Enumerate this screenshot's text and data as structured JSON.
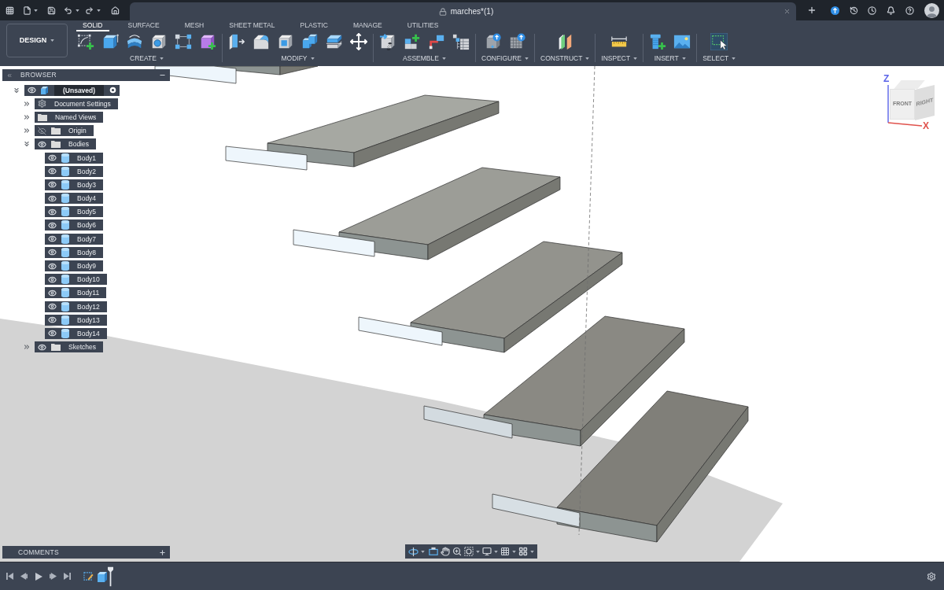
{
  "title_bar": {
    "document_tab": {
      "title": "marches*(1)"
    }
  },
  "toolbar": {
    "workspace": "DESIGN",
    "tabs": [
      {
        "label": "SOLID",
        "selected": true
      },
      {
        "label": "SURFACE",
        "selected": false
      },
      {
        "label": "MESH",
        "selected": false
      },
      {
        "label": "SHEET METAL",
        "selected": false
      },
      {
        "label": "PLASTIC",
        "selected": false
      },
      {
        "label": "MANAGE",
        "selected": false
      },
      {
        "label": "UTILITIES",
        "selected": false
      }
    ],
    "groups": [
      {
        "label": "CREATE",
        "active": false
      },
      {
        "label": "MODIFY",
        "active": false
      },
      {
        "label": "ASSEMBLE",
        "active": false
      },
      {
        "label": "CONFIGURE",
        "active": false
      },
      {
        "label": "CONSTRUCT",
        "active": false
      },
      {
        "label": "INSPECT",
        "active": false
      },
      {
        "label": "INSERT",
        "active": false
      },
      {
        "label": "SELECT",
        "active": true
      }
    ]
  },
  "browser": {
    "title": "BROWSER",
    "tree": [
      {
        "label": "(Unsaved)",
        "kind": "component",
        "expanded": true,
        "visible": true,
        "active": true,
        "children": [
          {
            "label": "Document Settings",
            "kind": "settings",
            "expanded": false
          },
          {
            "label": "Named Views",
            "kind": "folder",
            "expanded": false
          },
          {
            "label": "Origin",
            "kind": "folder",
            "expanded": false,
            "visible": false
          },
          {
            "label": "Bodies",
            "kind": "folder",
            "expanded": true,
            "visible": true,
            "children": [
              {
                "label": "Body1",
                "kind": "body",
                "visible": true
              },
              {
                "label": "Body2",
                "kind": "body",
                "visible": true
              },
              {
                "label": "Body3",
                "kind": "body",
                "visible": true
              },
              {
                "label": "Body4",
                "kind": "body",
                "visible": true
              },
              {
                "label": "Body5",
                "kind": "body",
                "visible": true
              },
              {
                "label": "Body6",
                "kind": "body",
                "visible": true
              },
              {
                "label": "Body7",
                "kind": "body",
                "visible": true
              },
              {
                "label": "Body8",
                "kind": "body",
                "visible": true
              },
              {
                "label": "Body9",
                "kind": "body",
                "visible": true
              },
              {
                "label": "Body10",
                "kind": "body",
                "visible": true
              },
              {
                "label": "Body11",
                "kind": "body",
                "visible": true
              },
              {
                "label": "Body12",
                "kind": "body",
                "visible": true
              },
              {
                "label": "Body13",
                "kind": "body",
                "visible": true
              },
              {
                "label": "Body14",
                "kind": "body",
                "visible": true
              }
            ]
          },
          {
            "label": "Sketches",
            "kind": "folder",
            "expanded": false,
            "visible": true
          }
        ]
      }
    ]
  },
  "comments": {
    "title": "COMMENTS"
  },
  "viewcube": {
    "front": "FRONT",
    "right": "RIGHT",
    "axes": [
      {
        "label": "Z",
        "color": "#5a63e8"
      },
      {
        "label": "X",
        "color": "#e0524c"
      }
    ]
  }
}
